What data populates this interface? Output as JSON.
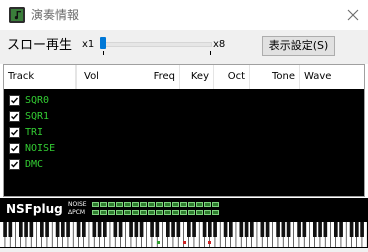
{
  "window": {
    "title": "演奏情報",
    "close_icon": "close-icon",
    "app_icon": "music-book-icon"
  },
  "controls": {
    "slow_label": "スロー再生",
    "min_label": "x1",
    "max_label": "x8",
    "slider_value": 1,
    "settings_button": "表示設定(S)"
  },
  "table": {
    "columns": [
      "Track",
      "Vol",
      "Freq",
      "Key",
      "Oct",
      "Tone",
      "Wave"
    ],
    "rows": [
      {
        "checked": true,
        "label": "SQR0"
      },
      {
        "checked": true,
        "label": "SQR1"
      },
      {
        "checked": true,
        "label": "TRI"
      },
      {
        "checked": true,
        "label": "NOISE"
      },
      {
        "checked": true,
        "label": "DMC"
      }
    ],
    "label_color": "#33cc33"
  },
  "status": {
    "plugin_name": "NSFplug",
    "meters": [
      {
        "label": "NOISE"
      },
      {
        "label": "ΔPCM"
      }
    ],
    "meter_color": "#2e7d2e"
  }
}
